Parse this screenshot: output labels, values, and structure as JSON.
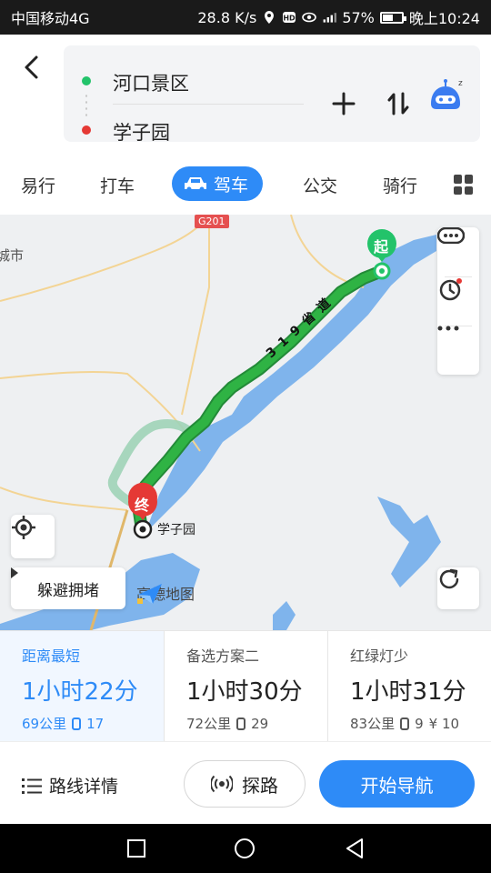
{
  "status_bar": {
    "carrier": "中国移动4G",
    "speed": "28.8 K/s",
    "battery": "57%",
    "battery_level": 0.57,
    "time": "晚上10:24"
  },
  "route": {
    "start": "河口景区",
    "end": "学子园"
  },
  "tabs": [
    "易行",
    "打车",
    "驾车",
    "公交",
    "骑行"
  ],
  "active_tab": "驾车",
  "map": {
    "road_badge": "G201",
    "city_label": "城市",
    "road_label": "319省道",
    "start_marker": "起",
    "end_marker": "终",
    "dest_label": "学子园",
    "avoid_label": "躲避拥堵",
    "logo": "高德地图"
  },
  "options": [
    {
      "label": "距离最短",
      "time": "1小时22分",
      "distance": "69公里",
      "lights": "17",
      "tolls": ""
    },
    {
      "label": "备选方案二",
      "time": "1小时30分",
      "distance": "72公里",
      "lights": "29",
      "tolls": ""
    },
    {
      "label": "红绿灯少",
      "time": "1小时31分",
      "distance": "83公里",
      "lights": "9",
      "tolls": "¥ 10"
    }
  ],
  "actions": {
    "detail": "路线详情",
    "explore": "探路",
    "navigate": "开始导航"
  },
  "colors": {
    "accent": "#2e8bf7",
    "route_green": "#2fb344",
    "start_green": "#23c36a",
    "end_red": "#e53935"
  }
}
